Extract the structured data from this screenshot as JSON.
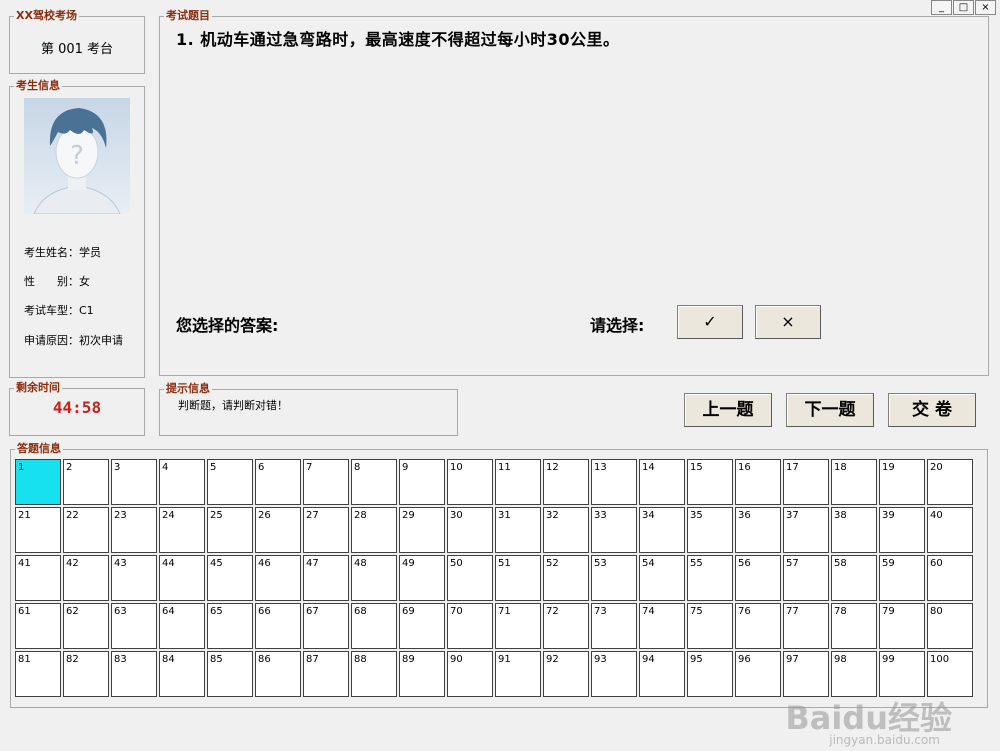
{
  "window": {
    "minimize": "_",
    "maximize": "□",
    "close": "×"
  },
  "venue": {
    "legend": "XX驾校考场",
    "seat": "第 001 考台"
  },
  "examinee": {
    "legend": "考生信息",
    "fields": [
      {
        "label": "考生姓名：",
        "value": "学员"
      },
      {
        "label": "性　　别：",
        "value": "女"
      },
      {
        "label": "考试车型：",
        "value": "C1"
      },
      {
        "label": "申请原因：",
        "value": "初次申请"
      }
    ]
  },
  "timer": {
    "legend": "剩余时间",
    "value": "44:58"
  },
  "question": {
    "legend": "考试题目",
    "text": "1. 机动车通过急弯路时，最高速度不得超过每小时30公里。",
    "answer_label": "您选择的答案:",
    "choose_label": "请选择:",
    "true_glyph": "✓",
    "false_glyph": "×"
  },
  "hint": {
    "legend": "提示信息",
    "text": "判断题，请判断对错！"
  },
  "nav": {
    "prev": "上一题",
    "next": "下一题",
    "submit": "交 卷"
  },
  "answers": {
    "legend": "答题信息",
    "active": 1,
    "active_color": "#17e0ef",
    "numbers": [
      1,
      2,
      3,
      4,
      5,
      6,
      7,
      8,
      9,
      10,
      11,
      12,
      13,
      14,
      15,
      16,
      17,
      18,
      19,
      20,
      21,
      22,
      23,
      24,
      25,
      26,
      27,
      28,
      29,
      30,
      31,
      32,
      33,
      34,
      35,
      36,
      37,
      38,
      39,
      40,
      41,
      42,
      43,
      44,
      45,
      46,
      47,
      48,
      49,
      50,
      51,
      52,
      53,
      54,
      55,
      56,
      57,
      58,
      59,
      60,
      61,
      62,
      63,
      64,
      65,
      66,
      67,
      68,
      69,
      70,
      71,
      72,
      73,
      74,
      75,
      76,
      77,
      78,
      79,
      80,
      81,
      82,
      83,
      84,
      85,
      86,
      87,
      88,
      89,
      90,
      91,
      92,
      93,
      94,
      95,
      96,
      97,
      98,
      99,
      100
    ]
  },
  "watermark": {
    "brand": "Baidu经验",
    "url": "jingyan.baidu.com"
  }
}
